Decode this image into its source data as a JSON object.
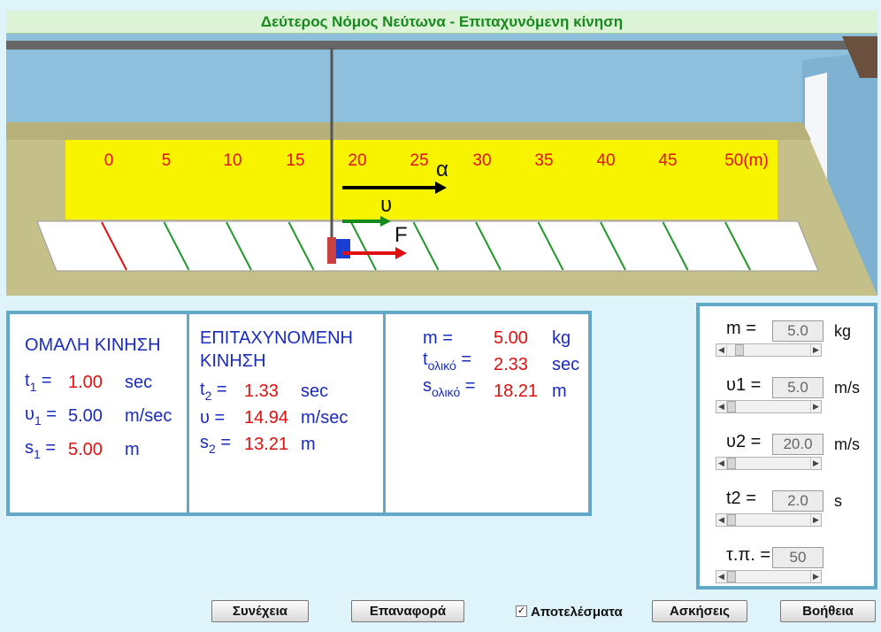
{
  "title": "Δεύτερος Νόμος Νεύτωνα - Επιταχυνόμενη κίνηση",
  "ruler": {
    "labels": [
      "0",
      "5",
      "10",
      "15",
      "20",
      "25",
      "30",
      "35",
      "40",
      "45",
      "50(m)"
    ]
  },
  "vectors": {
    "a_label": "α",
    "u_label": "υ",
    "f_label": "F"
  },
  "colors": {
    "panel_border": "#62a8c9",
    "value_red": "#e01010",
    "label_blue": "#1a2bbf",
    "title_green": "#178a1e",
    "ruler_yellow": "#f8f400"
  },
  "uniform": {
    "heading": "ΟΜΑΛΗ ΚΙΝΗΣΗ",
    "t1_sym": "t",
    "t1_sub": "1",
    "t1_eq": " =",
    "t1_val": "1.00",
    "t1_unit": "sec",
    "u1_sym": "υ",
    "u1_sub": "1",
    "u1_eq": " =",
    "u1_val": "5.00",
    "u1_unit": "m/sec",
    "s1_sym": "s",
    "s1_sub": "1",
    "s1_eq": " =",
    "s1_val": "5.00",
    "s1_unit": "m"
  },
  "accel": {
    "heading1": "ΕΠΙΤΑΧΥΝΟΜΕΝΗ",
    "heading2": "ΚΙΝΗΣΗ",
    "t2_sym": "t",
    "t2_sub": "2",
    "t2_eq": " =",
    "t2_val": "1.33",
    "t2_unit": "sec",
    "u_sym": "υ",
    "u_eq": " =",
    "u_val": "14.94",
    "u_unit": "m/sec",
    "s2_sym": "s",
    "s2_sub": "2",
    "s2_eq": " =",
    "s2_val": "13.21",
    "s2_unit": "m"
  },
  "totals": {
    "m_sym": "m =",
    "m_val": "5.00",
    "m_unit": "kg",
    "t_sym": "t",
    "t_sub": "ολικό",
    "t_eq": " =",
    "t_val": "2.33",
    "t_unit": "sec",
    "s_sym": "s",
    "s_sub": "ολικό",
    "s_eq": " =",
    "s_val": "18.21",
    "s_unit": "m"
  },
  "controls": [
    {
      "label": "m =",
      "value": "5.0",
      "unit": "kg",
      "level": 0.1
    },
    {
      "label": "υ1 =",
      "value": "5.0",
      "unit": "m/s",
      "level": 0.0
    },
    {
      "label": "υ2 =",
      "value": "20.0",
      "unit": "m/s",
      "level": 0.0
    },
    {
      "label": "t2 =",
      "value": "2.0",
      "unit": "s",
      "level": 0.0
    },
    {
      "label": "τ.π. =",
      "value": "50",
      "unit": "",
      "level": 0.0
    }
  ],
  "buttons": {
    "continue": "Συνέχεια",
    "reset": "Επαναφορά",
    "results": "Αποτελέσματα",
    "exercises": "Ασκήσεις",
    "help": "Βοήθεια"
  }
}
